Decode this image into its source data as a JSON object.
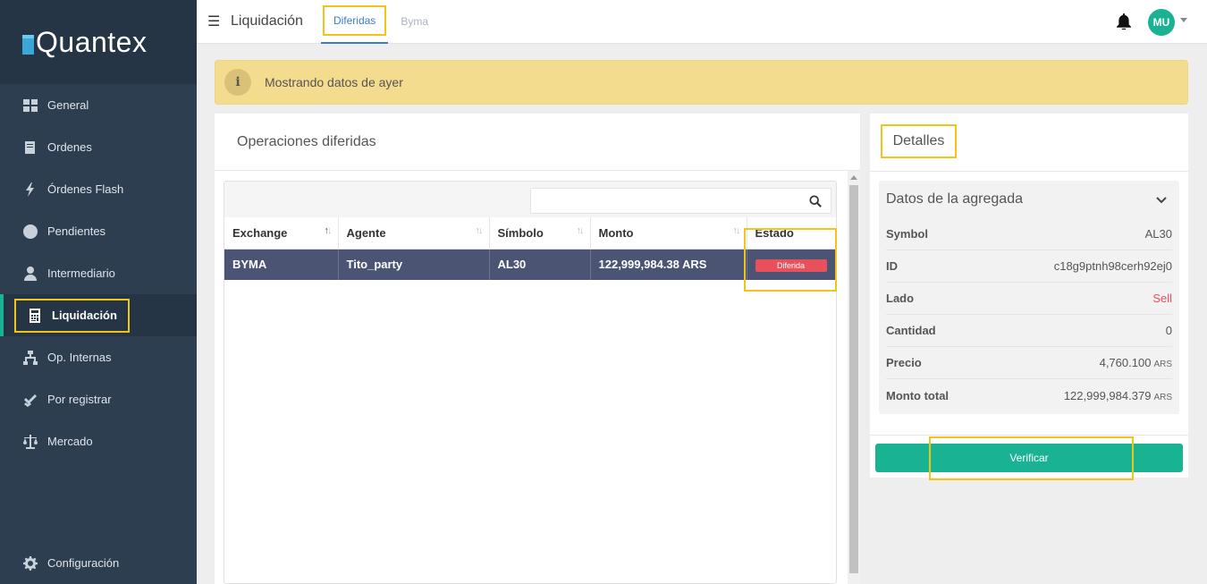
{
  "brand": {
    "name": "Quantex"
  },
  "sidebar": {
    "items": [
      {
        "label": "General",
        "icon": "grid-icon"
      },
      {
        "label": "Ordenes",
        "icon": "book-icon"
      },
      {
        "label": "Órdenes Flash",
        "icon": "lightning-icon"
      },
      {
        "label": "Pendientes",
        "icon": "clock-icon"
      },
      {
        "label": "Intermediario",
        "icon": "user-icon"
      },
      {
        "label": "Liquidación",
        "icon": "calculator-icon",
        "active": true
      },
      {
        "label": "Op. Internas",
        "icon": "network-icon"
      },
      {
        "label": "Por registrar",
        "icon": "check-double-icon"
      },
      {
        "label": "Mercado",
        "icon": "balance-scale-icon"
      }
    ],
    "settings_label": "Configuración"
  },
  "header": {
    "title": "Liquidación",
    "tabs": [
      {
        "label": "Diferidas",
        "active": true
      },
      {
        "label": "Byma",
        "active": false
      }
    ],
    "avatar_initials": "MU"
  },
  "alert": {
    "text": "Mostrando datos de ayer",
    "icon_glyph": "i"
  },
  "operations": {
    "title": "Operaciones diferidas",
    "search_placeholder": "",
    "columns": [
      "Exchange",
      "Agente",
      "Símbolo",
      "Monto",
      "Estado"
    ],
    "rows": [
      {
        "exchange": "BYMA",
        "agente": "Tito_party",
        "simbolo": "AL30",
        "monto": "122,999,984.38 ARS",
        "estado": "Diferida"
      }
    ]
  },
  "details": {
    "title": "Detalles",
    "card_title": "Datos de la agregada",
    "fields": [
      {
        "label": "Symbol",
        "value": "AL30",
        "unit": ""
      },
      {
        "label": "ID",
        "value": "c18g9ptnh98cerh92ej0",
        "unit": ""
      },
      {
        "label": "Lado",
        "value": "Sell",
        "unit": ""
      },
      {
        "label": "Cantidad",
        "value": "0",
        "unit": ""
      },
      {
        "label": "Precio",
        "value": "4,760.100",
        "unit": "ARS"
      },
      {
        "label": "Monto total",
        "value": "122,999,984.379",
        "unit": "ARS"
      }
    ],
    "verify_label": "Verificar"
  },
  "colors": {
    "sidebar_bg": "#2d3e50",
    "accent_green": "#19b394",
    "highlight_yellow": "#f0c419",
    "alert_bg": "#f4dc8e",
    "row_selected_bg": "#4b5472",
    "status_red": "#e8505b",
    "tab_blue": "#3a7bd5"
  }
}
